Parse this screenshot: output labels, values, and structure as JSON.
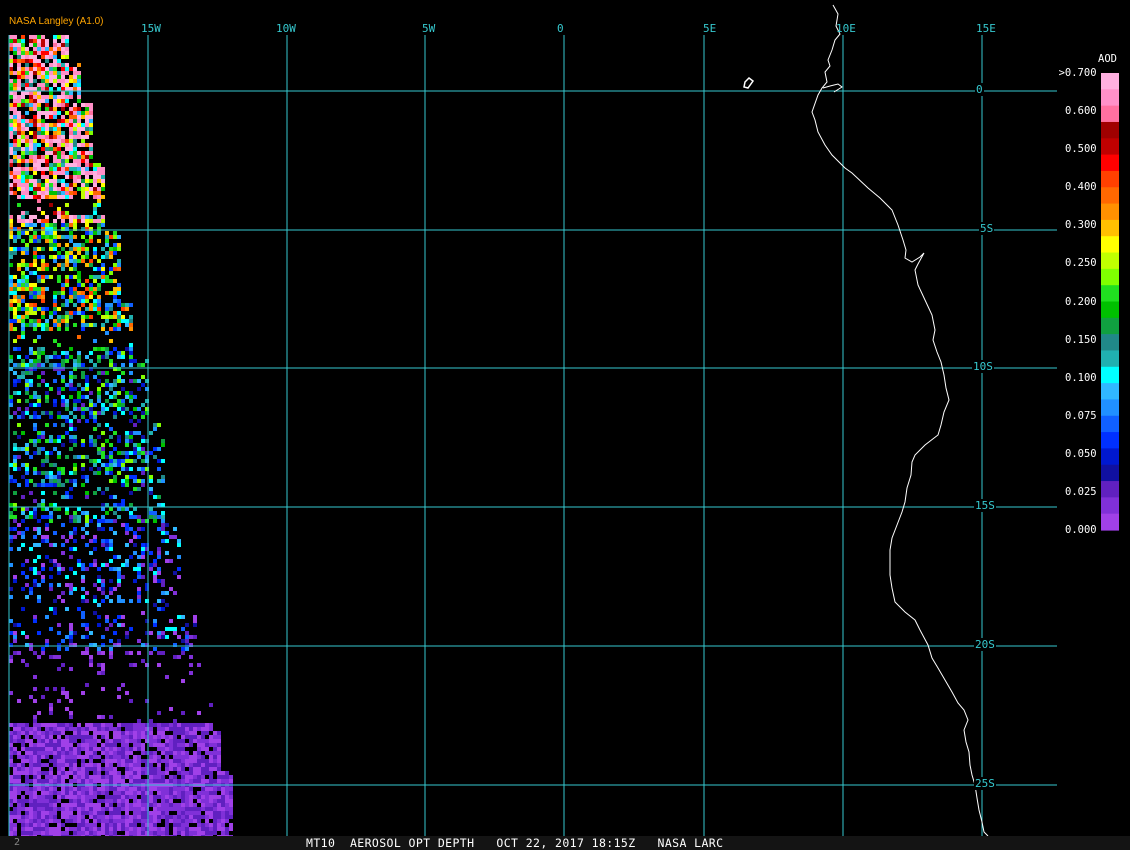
{
  "source_label": "NASA Langley (A1.0)",
  "footer_text": "MT10  AEROSOL OPT DEPTH   OCT 22, 2017 18:15Z   NASA LARC",
  "footer_corner": "2",
  "colors": {
    "grid": "#36c9cf",
    "label": "#36c9cf",
    "coast": "#ffffff",
    "source": "#ffa500",
    "text": "#ffffff"
  },
  "map": {
    "lon_labels": [
      "15W",
      "10W",
      "5W",
      "0",
      "5E",
      "10E",
      "15E"
    ],
    "lat_labels": [
      "0",
      "5S",
      "10S",
      "15S",
      "20S",
      "25S"
    ]
  },
  "colorbar": {
    "title": "AOD",
    "colors": [
      "#a040e8",
      "#8030d8",
      "#6020c0",
      "#1010a0",
      "#0018d0",
      "#0030ff",
      "#1060ff",
      "#2090ff",
      "#30b8ff",
      "#00ffff",
      "#20b0b0",
      "#208888",
      "#10a040",
      "#00c000",
      "#20e020",
      "#80ff00",
      "#c0ff00",
      "#ffff00",
      "#ffc000",
      "#ff9000",
      "#ff6800",
      "#ff4000",
      "#ff0000",
      "#c00000",
      "#a00000",
      "#ff70a0",
      "#ff90c8",
      "#ffb0e0"
    ],
    "tick_labels": [
      "0.000",
      "0.025",
      "0.050",
      "0.075",
      "0.100",
      "0.150",
      "0.200",
      "0.250",
      "0.300",
      "0.400",
      "0.500",
      "0.600",
      ">0.700"
    ]
  }
}
